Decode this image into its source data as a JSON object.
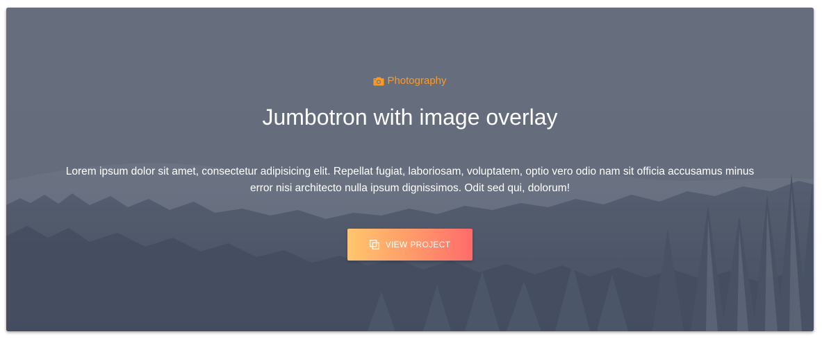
{
  "jumbotron": {
    "category": {
      "icon": "camera-icon",
      "label": "Photography",
      "color": "#ff9a1f"
    },
    "title": "Jumbotron with image overlay",
    "description": "Lorem ipsum dolor sit amet, consectetur adipisicing elit. Repellat fugiat, laboriosam, voluptatem, optio vero odio nam sit officia accusamus minus error nisi architecto nulla ipsum dignissimos. Odit sed qui, dolorum!",
    "button": {
      "icon": "copy-icon",
      "label": "VIEW PROJECT",
      "gradient_start": "#ffc66d",
      "gradient_end": "#ff6b6b"
    },
    "background": {
      "description_icon": "snowy-forest-image"
    }
  }
}
